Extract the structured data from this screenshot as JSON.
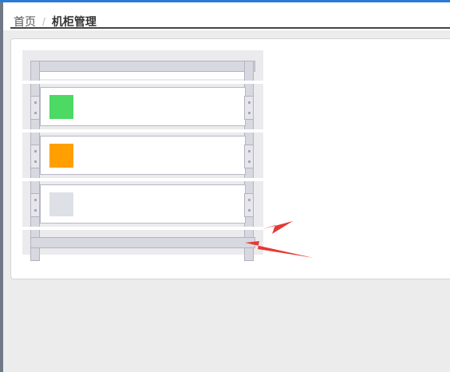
{
  "breadcrumb": {
    "home": "首页",
    "separator": "/",
    "current": "机柜管理"
  },
  "colors": {
    "accent_top": "#2b7bd6",
    "status_online": "#4cd964",
    "status_warning": "#ff9f00",
    "status_empty": "#dde0e6",
    "annotation_arrow": "#e53935"
  },
  "rack": {
    "slots": [
      {
        "status": "online",
        "color": "#4cd964"
      },
      {
        "status": "warning",
        "color": "#ff9f00"
      },
      {
        "status": "empty",
        "color": "#dde0e6"
      }
    ]
  },
  "annotations": {
    "arrows": [
      "arrow-icon",
      "arrow-icon"
    ]
  }
}
